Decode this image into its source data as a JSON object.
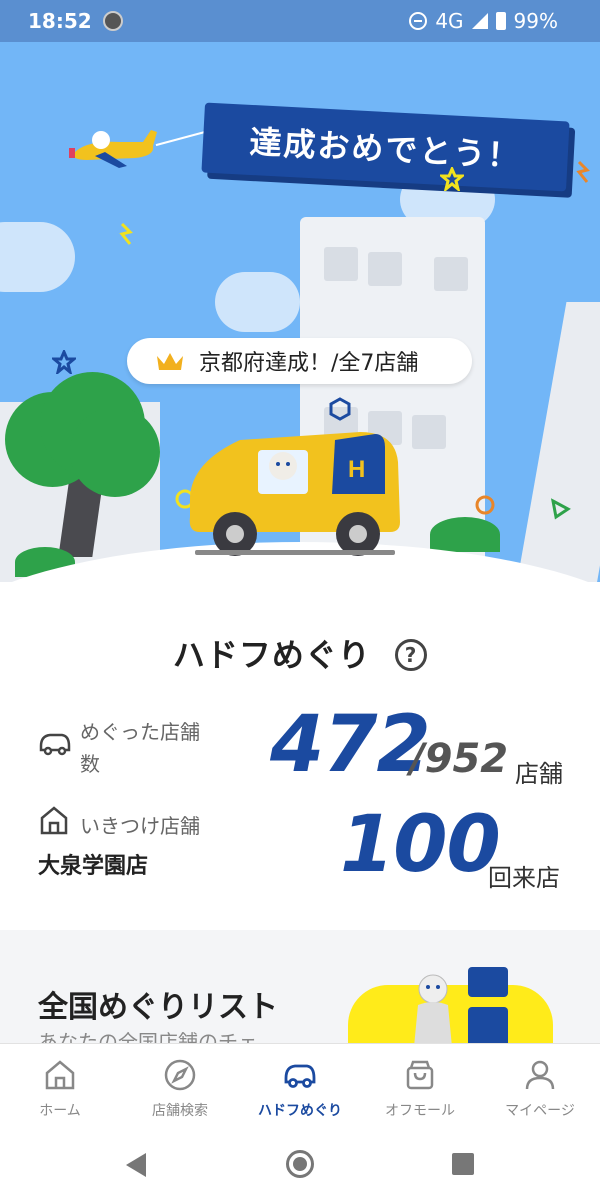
{
  "status_bar": {
    "time": "18:52",
    "network": "4G",
    "battery": "99%"
  },
  "hero": {
    "banner_text": "達成おめでとう！",
    "achievement_text": "京都府達成！/全7店舗",
    "car_logo": "H"
  },
  "stats": {
    "title": "ハドフめぐり",
    "help_icon": "?",
    "visited_label": "めぐった店舗",
    "visited_label_2": "数",
    "visited_count": "472",
    "total_stores": "/952",
    "stores_unit": "店舗",
    "favorite_label": "いきつけ店舗",
    "favorite_store": "大泉学園店",
    "favorite_visits": "100",
    "visits_unit": "回来店"
  },
  "list_section": {
    "title": "全国めぐりリスト",
    "description": "あなたの全国店舗のチェ"
  },
  "bottom_nav": {
    "items": [
      {
        "label": "ホーム",
        "icon": "home-icon"
      },
      {
        "label": "店舗検索",
        "icon": "compass-icon"
      },
      {
        "label": "ハドフめぐり",
        "icon": "car-icon",
        "active": true
      },
      {
        "label": "オフモール",
        "icon": "shopping-bag-icon"
      },
      {
        "label": "マイページ",
        "icon": "person-icon"
      }
    ]
  },
  "colors": {
    "brand_blue": "#1b4aa0",
    "sky": "#72b6f7",
    "car_yellow": "#f2c21e",
    "tree_green": "#2ea24a"
  }
}
